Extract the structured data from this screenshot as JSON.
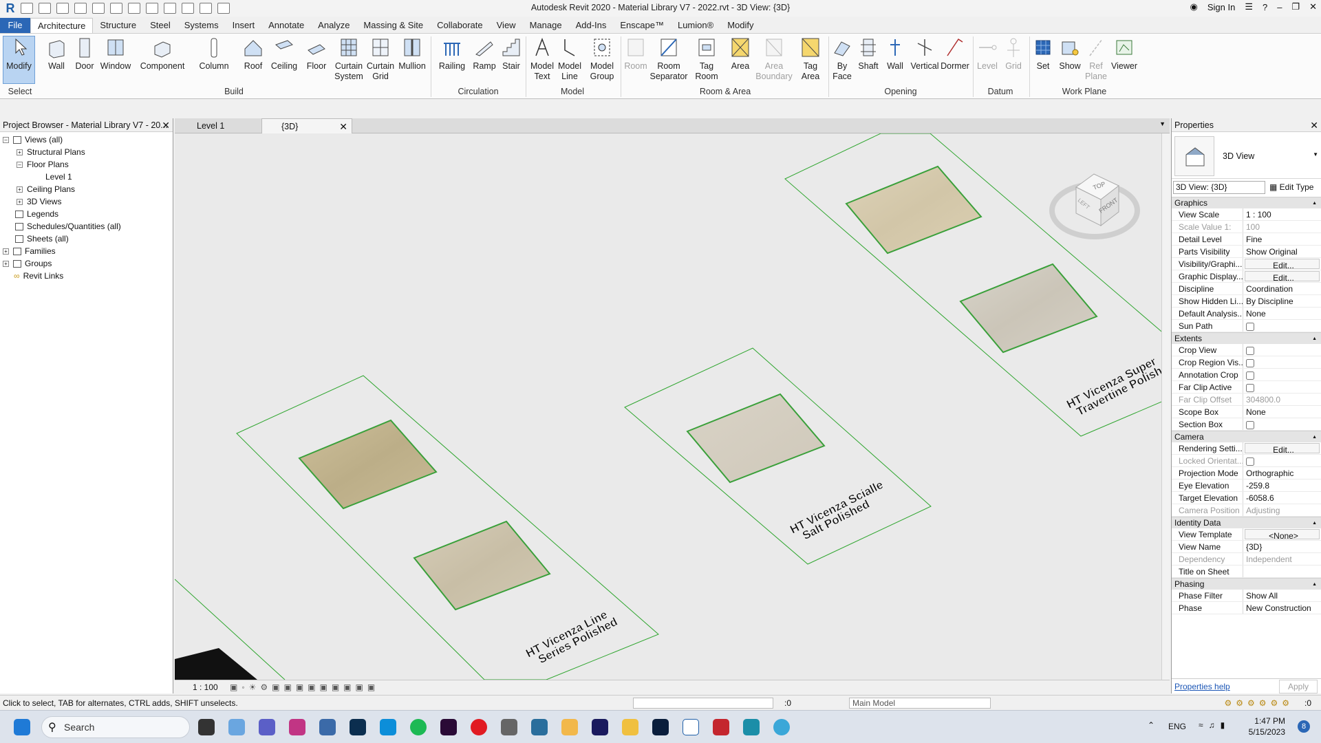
{
  "window": {
    "title": "Autodesk Revit 2020 - Material Library V7 - 2022.rvt - 3D View: {3D}",
    "sign_in": "Sign In"
  },
  "tabs": [
    "File",
    "Architecture",
    "Structure",
    "Steel",
    "Systems",
    "Insert",
    "Annotate",
    "Analyze",
    "Massing & Site",
    "Collaborate",
    "View",
    "Manage",
    "Add-Ins",
    "Enscape™",
    "Lumion®",
    "Modify"
  ],
  "ribbon": {
    "modify": "Modify",
    "select": "Select",
    "build": {
      "label": "Build",
      "items": [
        "Wall",
        "Door",
        "Window",
        "Component",
        "Column",
        "Roof",
        "Ceiling",
        "Floor",
        "Curtain System",
        "Curtain Grid",
        "Mullion"
      ]
    },
    "circulation": {
      "label": "Circulation",
      "items": [
        "Railing",
        "Ramp",
        "Stair"
      ]
    },
    "model": {
      "label": "Model",
      "items": [
        "Model Text",
        "Model Line",
        "Model Group"
      ]
    },
    "room_area": {
      "label": "Room & Area",
      "items": [
        "Room",
        "Room Separator",
        "Tag Room",
        "Area",
        "Area Boundary",
        "Tag Area"
      ]
    },
    "opening": {
      "label": "Opening",
      "items": [
        "By Face",
        "Shaft",
        "Wall",
        "Vertical",
        "Dormer"
      ]
    },
    "datum": {
      "label": "Datum",
      "items": [
        "Level",
        "Grid"
      ]
    },
    "workplane": {
      "label": "Work Plane",
      "items": [
        "Set",
        "Show",
        "Ref Plane",
        "Viewer"
      ]
    }
  },
  "project_browser": {
    "title": "Project Browser - Material Library V7 - 20...",
    "items": [
      "Views (all)",
      "Structural Plans",
      "Floor Plans",
      "Level 1",
      "Ceiling Plans",
      "3D Views",
      "Legends",
      "Schedules/Quantities (all)",
      "Sheets (all)",
      "Families",
      "Groups",
      "Revit Links"
    ]
  },
  "view_tabs": [
    "Level 1",
    "{3D}"
  ],
  "viewport": {
    "labels": [
      {
        "line1": "HT Vicenza Line",
        "line2": "Series Polished"
      },
      {
        "line1": "HT Vicenza Scialle",
        "line2": "Salt Polished"
      },
      {
        "line1": "HT Vicenza Super",
        "line2": "Travertine Polish"
      }
    ],
    "viewcube": {
      "top": "TOP",
      "front": "FRONT",
      "left": "LEFT"
    },
    "scale": "1 : 100"
  },
  "properties": {
    "title": "Properties",
    "type_name": "3D View",
    "instance": "3D View: {3D}",
    "edit_type": "Edit Type",
    "groups": [
      {
        "name": "Graphics",
        "rows": [
          [
            "View Scale",
            "1 : 100"
          ],
          [
            "Scale Value    1:",
            "100"
          ],
          [
            "Detail Level",
            "Fine"
          ],
          [
            "Parts Visibility",
            "Show Original"
          ],
          [
            "Visibility/Graphi...",
            "Edit..."
          ],
          [
            "Graphic Display...",
            "Edit..."
          ],
          [
            "Discipline",
            "Coordination"
          ],
          [
            "Show Hidden Li...",
            "By Discipline"
          ],
          [
            "Default Analysis...",
            "None"
          ],
          [
            "Sun Path",
            ""
          ]
        ]
      },
      {
        "name": "Extents",
        "rows": [
          [
            "Crop View",
            ""
          ],
          [
            "Crop Region Vis...",
            ""
          ],
          [
            "Annotation Crop",
            ""
          ],
          [
            "Far Clip Active",
            ""
          ],
          [
            "Far Clip Offset",
            "304800.0"
          ],
          [
            "Scope Box",
            "None"
          ],
          [
            "Section Box",
            ""
          ]
        ]
      },
      {
        "name": "Camera",
        "rows": [
          [
            "Rendering Setti...",
            "Edit..."
          ],
          [
            "Locked Orientat...",
            ""
          ],
          [
            "Projection Mode",
            "Orthographic"
          ],
          [
            "Eye Elevation",
            "-259.8"
          ],
          [
            "Target Elevation",
            "-6058.6"
          ],
          [
            "Camera Position",
            "Adjusting"
          ]
        ]
      },
      {
        "name": "Identity Data",
        "rows": [
          [
            "View Template",
            "<None>"
          ],
          [
            "View Name",
            "{3D}"
          ],
          [
            "Dependency",
            "Independent"
          ],
          [
            "Title on Sheet",
            ""
          ]
        ]
      },
      {
        "name": "Phasing",
        "rows": [
          [
            "Phase Filter",
            "Show All"
          ],
          [
            "Phase",
            "New Construction"
          ]
        ]
      }
    ],
    "help": "Properties help",
    "apply": "Apply"
  },
  "status": {
    "text": "Click to select, TAB for alternates, CTRL adds, SHIFT unselects.",
    "model": "Main Model",
    "zero": ":0"
  },
  "taskbar": {
    "search": "Search",
    "lang": "ENG",
    "time": "1:47 PM",
    "date": "5/15/2023",
    "badge": "8"
  }
}
